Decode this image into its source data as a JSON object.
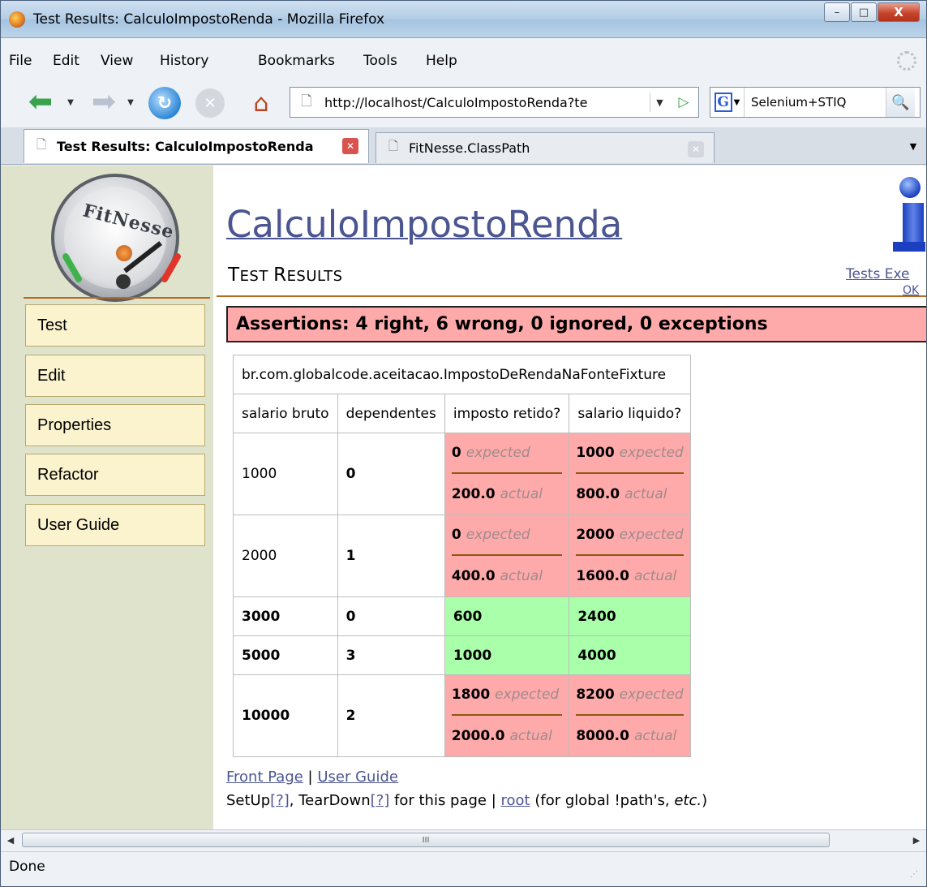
{
  "window": {
    "title": "Test Results: CalculoImpostoRenda - Mozilla Firefox",
    "minimize_glyph": "–",
    "maximize_glyph": "□",
    "close_glyph": "X"
  },
  "menu": [
    "File",
    "Edit",
    "View",
    "History",
    "Bookmarks",
    "Tools",
    "Help"
  ],
  "nav": {
    "url": "http://localhost/CalculoImpostoRenda?te",
    "search_value": "Selenium+STIQ",
    "search_engine": "G"
  },
  "tabs": {
    "active": "Test Results: CalculoImpostoRenda",
    "inactive": "FitNesse.ClassPath"
  },
  "sidebar": {
    "logo_text": "FitNesse",
    "items": [
      "Test",
      "Edit",
      "Properties",
      "Refactor",
      "User Guide"
    ]
  },
  "page": {
    "title": "CalculoImpostoRenda",
    "subtitle_big_1": "T",
    "subtitle_small_1": "EST ",
    "subtitle_big_2": "R",
    "subtitle_small_2": "ESULTS",
    "tests_exec_link": "Tests Exe",
    "ok_link": "OK",
    "assertions": "Assertions: 4 right, 6 wrong, 0 ignored, 0 exceptions"
  },
  "fixture": {
    "name": "br.com.globalcode.aceitacao.ImpostoDeRendaNaFonteFixture",
    "headers": [
      "salario bruto",
      "dependentes",
      "imposto retido?",
      "salario liquido?"
    ],
    "expected_label": "expected",
    "actual_label": "actual",
    "rows": [
      {
        "salario": "1000",
        "dependentes": "0",
        "imposto_expected": "0",
        "imposto_actual": "200.0",
        "liquido_expected": "1000",
        "liquido_actual": "800.0"
      },
      {
        "salario": "2000",
        "dependentes": "1",
        "imposto_expected": "0",
        "imposto_actual": "400.0",
        "liquido_expected": "2000",
        "liquido_actual": "1600.0"
      },
      {
        "salario": "3000",
        "dependentes": "0",
        "imposto": "600",
        "liquido": "2400"
      },
      {
        "salario": "5000",
        "dependentes": "3",
        "imposto": "1000",
        "liquido": "4000"
      },
      {
        "salario": "10000",
        "dependentes": "2",
        "imposto_expected": "1800",
        "imposto_actual": "2000.0",
        "liquido_expected": "8200",
        "liquido_actual": "8000.0"
      }
    ]
  },
  "footer": {
    "front_page": "Front Page",
    "sep": " | ",
    "user_guide": "User Guide",
    "setup": "SetUp",
    "q1": "[?]",
    "teardown": ", TearDown",
    "q2": "[?]",
    "for_this_page": " for this page | ",
    "root": "root",
    "global_paths_pre": " (for global !path's, ",
    "etc": "etc.",
    "global_paths_post": ")"
  },
  "scrollbar": {
    "thumb_grip": "III"
  },
  "status": "Done",
  "colors": {
    "fail": "#ffaaaa",
    "pass": "#aaffaa",
    "sidebar": "#dfe3cb",
    "link": "#4b5591",
    "rule": "#b86a1e"
  }
}
